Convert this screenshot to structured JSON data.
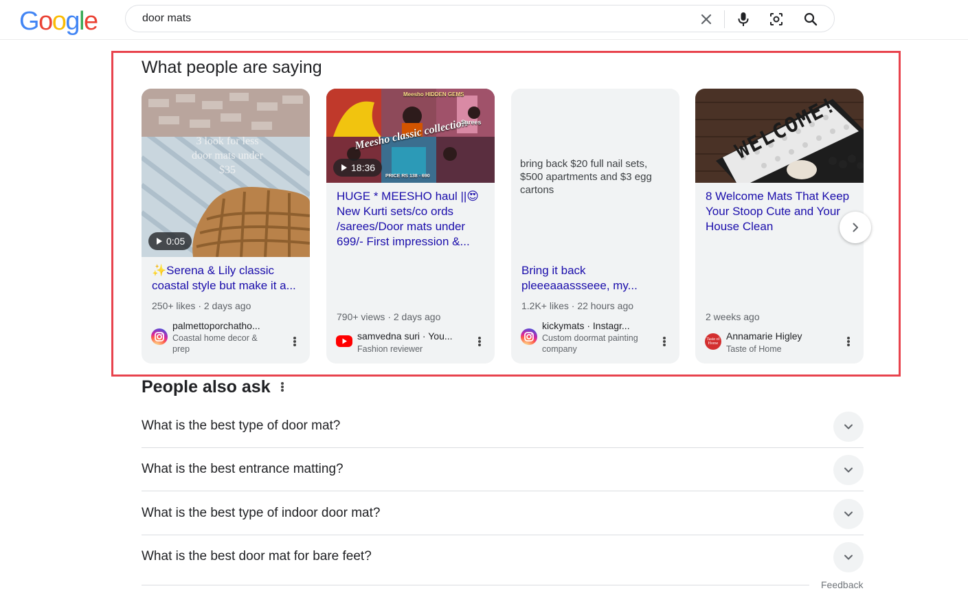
{
  "search": {
    "query": "door mats",
    "logo_letters": [
      {
        "ch": "G",
        "color": "#4285F4"
      },
      {
        "ch": "o",
        "color": "#EA4335"
      },
      {
        "ch": "o",
        "color": "#FBBC05"
      },
      {
        "ch": "g",
        "color": "#4285F4"
      },
      {
        "ch": "l",
        "color": "#34A853"
      },
      {
        "ch": "e",
        "color": "#EA4335"
      }
    ]
  },
  "highlight_color": "#e8434d",
  "link_color": "#1a0dab",
  "section": {
    "title": "What people are saying",
    "cards": [
      {
        "thumb_text": "3 look for less door mats under $35",
        "duration": "0:05",
        "title_emoji": "✨",
        "title": "Serena & Lily classic coastal style but make it a...",
        "meta": "250+ likes · 2 days ago",
        "source_icon": "instagram-icon",
        "source_name": "palmettoporchatho...",
        "source_sub": "Coastal home decor & prep"
      },
      {
        "thumb_text": "Meesho classic collection",
        "thumb_price": "PRICE RS 138 - 690",
        "thumb_sarees": "Sarees",
        "thumb_top": "Meesho HIDDEN GEMS",
        "duration": "18:36",
        "title": "HUGE * MEESHO haul ||😍 New Kurti sets/co ords /sarees/Door mats under 699/- First impression &...",
        "meta": "790+ views · 2 days ago",
        "source_icon": "youtube-icon",
        "source_name": "samvedna suri · You...",
        "source_sub": "Fashion reviewer"
      },
      {
        "quote": "bring back $20 full nail sets, $500 apartments and $3 egg cartons",
        "title": "Bring it back pleeeaaassseee, my...",
        "meta": "1.2K+ likes · 22 hours ago",
        "source_icon": "instagram-icon",
        "source_name": "kickymats · Instagr...",
        "source_sub": "Custom doormat painting company"
      },
      {
        "thumb_text": "WELCOME!",
        "title": "8 Welcome Mats That Keep Your Stoop Cute and Your House Clean",
        "meta": "2 weeks ago",
        "source_icon": "taste-of-home-icon",
        "source_logo_text": "Taste of Home",
        "source_name": "Annamarie Higley",
        "source_sub": "Taste of Home"
      }
    ]
  },
  "paa": {
    "title": "People also ask",
    "questions": [
      "What is the best type of door mat?",
      "What is the best entrance matting?",
      "What is the best type of indoor door mat?",
      "What is the best door mat for bare feet?"
    ],
    "feedback": "Feedback"
  }
}
